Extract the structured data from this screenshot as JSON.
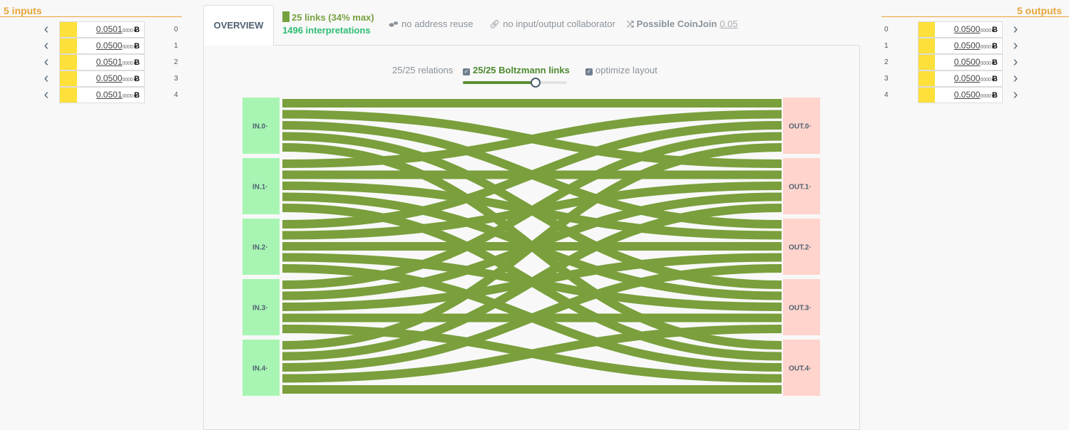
{
  "inputs": {
    "title": "5 inputs",
    "rows": [
      {
        "index": "0",
        "main": "0.0501",
        "small": "0000",
        "unit": "Ƀ",
        "fill": 0.2
      },
      {
        "index": "1",
        "main": "0.0500",
        "small": "0000",
        "unit": "Ƀ",
        "fill": 0.2
      },
      {
        "index": "2",
        "main": "0.0501",
        "small": "0000",
        "unit": "Ƀ",
        "fill": 0.2
      },
      {
        "index": "3",
        "main": "0.0500",
        "small": "0000",
        "unit": "Ƀ",
        "fill": 0.2
      },
      {
        "index": "4",
        "main": "0.0501",
        "small": "0000",
        "unit": "Ƀ",
        "fill": 0.2
      }
    ]
  },
  "outputs": {
    "title": "5 outputs",
    "rows": [
      {
        "index": "0",
        "main": "0.0500",
        "small": "0000",
        "unit": "Ƀ",
        "fill": 0.2
      },
      {
        "index": "1",
        "main": "0.0500",
        "small": "0000",
        "unit": "Ƀ",
        "fill": 0.2
      },
      {
        "index": "2",
        "main": "0.0500",
        "small": "0000",
        "unit": "Ƀ",
        "fill": 0.2
      },
      {
        "index": "3",
        "main": "0.0500",
        "small": "0000",
        "unit": "Ƀ",
        "fill": 0.2
      },
      {
        "index": "4",
        "main": "0.0500",
        "small": "0000",
        "unit": "Ƀ",
        "fill": 0.2
      }
    ]
  },
  "header": {
    "overview_tab": "OVERVIEW",
    "links_text": "25 links (34% max)",
    "interpretations_text": "1496 interpretations",
    "heuristics": [
      {
        "icon": "footprint-icon",
        "label": "no address reuse"
      },
      {
        "icon": "link-icon",
        "label": "no input/output collaborator"
      },
      {
        "icon": "shuffle-icon",
        "label": "Possible CoinJoin",
        "score": "0.05"
      }
    ]
  },
  "controls": {
    "relations_label": "25/25 relations",
    "boltzmann_label": "25/25 Boltzmann links",
    "optimize_label": "optimize layout",
    "slider_fraction": 0.7
  },
  "diagram": {
    "input_labels": [
      "IN.0·",
      "IN.1·",
      "IN.2·",
      "IN.3·",
      "IN.4·"
    ],
    "output_labels": [
      "OUT.0·",
      "OUT.1·",
      "OUT.2·",
      "OUT.3·",
      "OUT.4·"
    ],
    "link_color": "#7a9f3c",
    "input_color": "#a8f5b3",
    "output_color": "#ffd4cc"
  },
  "colors": {
    "accent": "#e6a53a",
    "amount_bar": "#fde03a",
    "links_green": "#76a141",
    "interp_green": "#2ebd74"
  }
}
